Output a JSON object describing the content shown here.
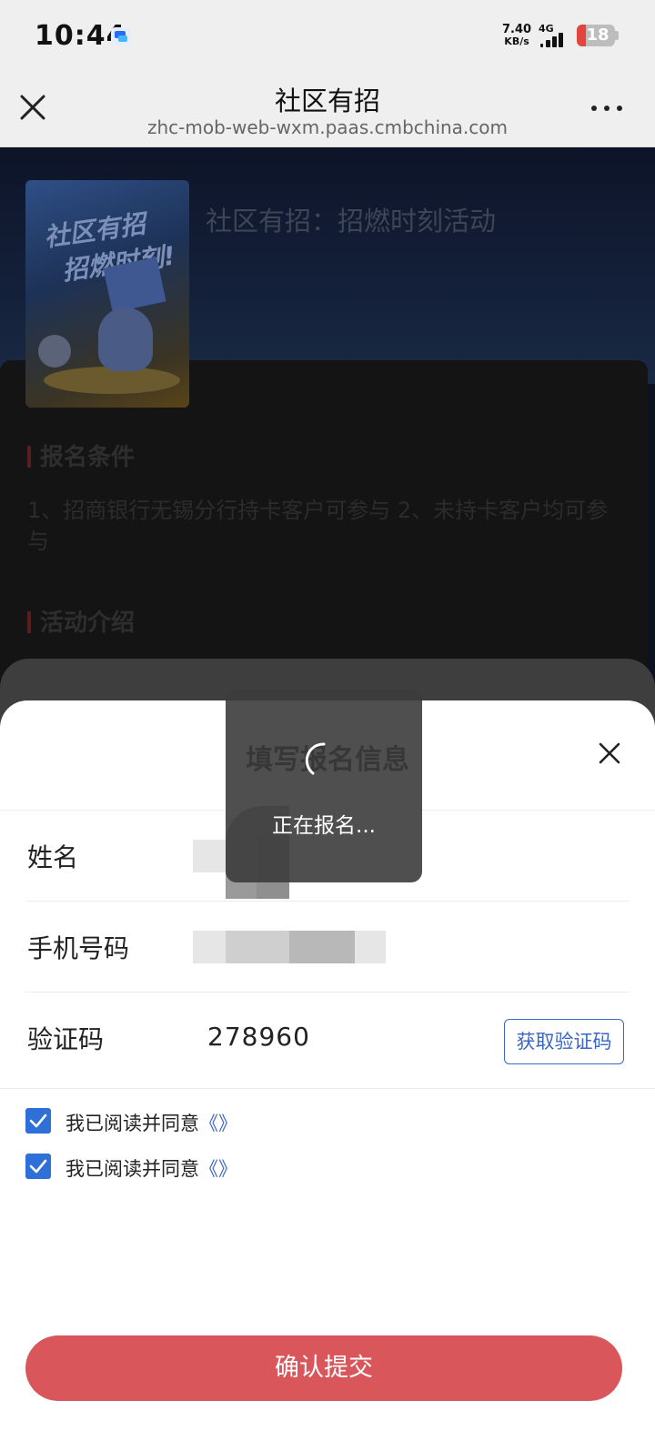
{
  "status_bar": {
    "time": "10:44",
    "net_speed_value": "7.40",
    "net_speed_unit": "KB/s",
    "network_type": "4G",
    "battery": "18",
    "app_icon": "message-app-icon"
  },
  "nav": {
    "title": "社区有招",
    "url": "zhc-mob-web-wxm.paas.cmbchina.com",
    "close_icon": "close-icon",
    "more_icon": "more-icon"
  },
  "page": {
    "activity_title": "社区有招：招燃时刻活动",
    "poster_text_line1": "社区有招",
    "poster_text_line2": "招燃时刻!",
    "sections": [
      {
        "heading": "报名条件",
        "text": "1、招商银行无锡分行持卡客户可参与 2、未持卡客户均可参与"
      },
      {
        "heading": "活动介绍",
        "text": ""
      }
    ]
  },
  "form": {
    "title": "填写报名信息",
    "close_icon": "close-icon",
    "fields": [
      {
        "label": "姓名",
        "value": ""
      },
      {
        "label": "手机号码",
        "value": ""
      },
      {
        "label": "验证码",
        "value": "278960"
      }
    ],
    "get_code_label": "获取验证码",
    "agreements": [
      {
        "prefix": "我已阅读并同意",
        "link": "《》",
        "checked": true
      },
      {
        "prefix": "我已阅读并同意",
        "link": "《》",
        "checked": true
      }
    ],
    "submit_label": "确认提交"
  },
  "toast": {
    "message": "正在报名..."
  },
  "colors": {
    "accent_blue": "#3b66c4",
    "submit_red": "#d9565b",
    "battery_red": "#e3453d"
  }
}
